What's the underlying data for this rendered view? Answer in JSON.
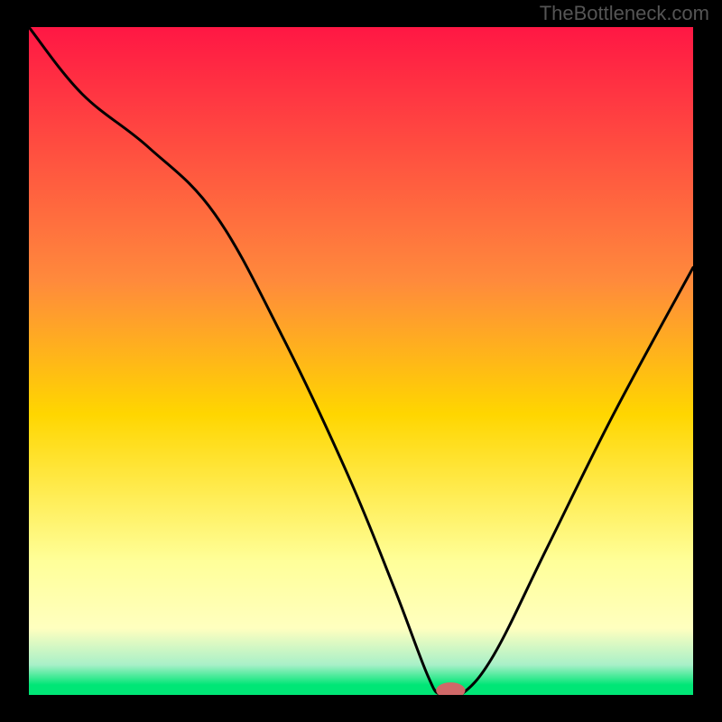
{
  "watermark": "TheBottleneck.com",
  "colors": {
    "frame": "#000000",
    "gradientTop": "#ff1744",
    "gradientMid": "#ffd600",
    "gradientLight": "#ffffbf",
    "gradientLow": "#a8f0c8",
    "gradientBottom": "#00e676",
    "curve": "#000000",
    "marker": "#d06868"
  },
  "chart_data": {
    "type": "line",
    "title": "",
    "xlabel": "",
    "ylabel": "",
    "xlim": [
      0,
      100
    ],
    "ylim": [
      0,
      100
    ],
    "series": [
      {
        "name": "bottleneck-curve",
        "x": [
          0,
          8,
          18,
          28,
          38,
          48,
          55,
          60,
          62,
          65,
          70,
          78,
          88,
          100
        ],
        "y": [
          100,
          90,
          82,
          72,
          54,
          33,
          16,
          3,
          0,
          0,
          6,
          22,
          42,
          64
        ]
      }
    ],
    "marker": {
      "x": 63.5,
      "y": 0,
      "rx": 2.2,
      "ry": 1.2
    },
    "annotations": []
  }
}
